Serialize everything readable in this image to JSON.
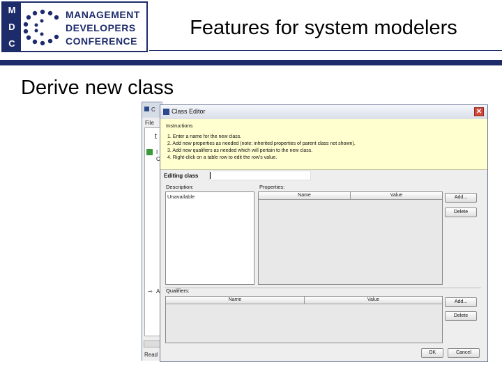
{
  "slide": {
    "title": "Features for system modelers",
    "subtitle": "Derive new class",
    "logo": {
      "letters": [
        "M",
        "D",
        "C"
      ],
      "words": [
        "MANAGEMENT",
        "DEVELOPERS",
        "CONFERENCE"
      ]
    }
  },
  "background_window": {
    "title_fragment": "C",
    "menu_fragment": "File",
    "status_fragment": "Read",
    "tree_fragments": [
      "t",
      "I",
      "C",
      "A"
    ]
  },
  "dialog": {
    "title": "Class Editor",
    "close_symbol": "✕",
    "instructions_heading": "Instructions",
    "instructions": [
      "1. Enter a name for the new class.",
      "2. Add new properties as needed (note: inherited properties of parent class not shown).",
      "3. Add new qualifiers as needed which will pertain to the new class.",
      "4. Right-click on a table row to edit the row's value."
    ],
    "editing_label": "Editing class",
    "editing_value": "",
    "description_label": "Description:",
    "description_value": "Unavailable",
    "properties_label": "Properties:",
    "properties_columns": [
      "Name",
      "Value"
    ],
    "qualifiers_label": "Qualifiers:",
    "qualifiers_columns": [
      "Name",
      "Value"
    ],
    "add_label": "Add...",
    "delete_label": "Delete",
    "ok_label": "OK",
    "cancel_label": "Cancel"
  },
  "colors": {
    "brand_navy": "#1d2b6b",
    "instructions_bg": "#ffffd0",
    "close_red": "#d24a3a"
  }
}
